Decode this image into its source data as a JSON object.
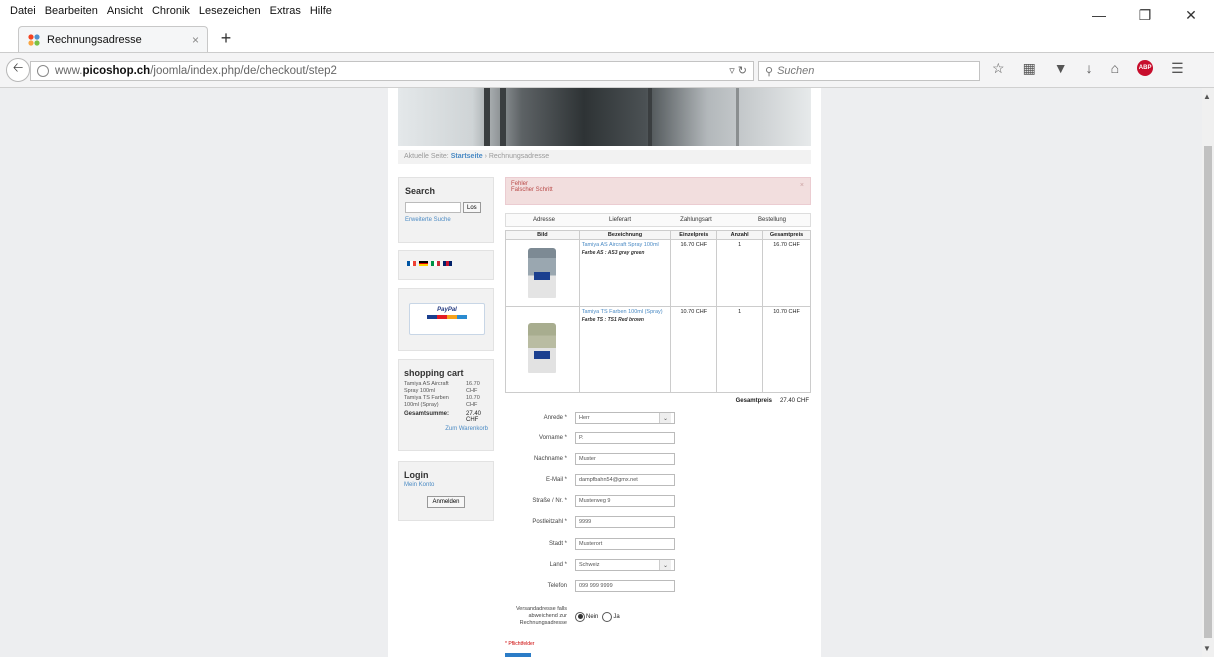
{
  "menu": [
    "Datei",
    "Bearbeiten",
    "Ansicht",
    "Chronik",
    "Lesezeichen",
    "Extras",
    "Hilfe"
  ],
  "tab": {
    "title": "Rechnungsadresse",
    "close": "×",
    "new": "+"
  },
  "url": {
    "prefix": "www.",
    "domain": "picoshop.ch",
    "path": "/joomla/index.php/de/checkout/step2"
  },
  "search_placeholder": "Suchen",
  "breadcrumb": {
    "label": "Aktuelle Seite:",
    "home": "Startseite",
    "sep": "›",
    "current": "Rechnungsadresse"
  },
  "sidebar": {
    "search": {
      "title": "Search",
      "button": "Los",
      "advanced": "Erweiterte Suche"
    },
    "cart": {
      "title": "shopping cart",
      "items": [
        {
          "name": "Tamiya AS Aircraft Spray 100ml",
          "price": "16.70 CHF"
        },
        {
          "name": "Tamiya TS Farben 100ml (Spray)",
          "price": "10.70 CHF"
        }
      ],
      "total_label": "Gesamtsumme:",
      "total": "27.40 CHF",
      "link": "Zum Warenkorb"
    },
    "login": {
      "title": "Login",
      "account": "Mein Konto",
      "button": "Anmelden"
    }
  },
  "alert": {
    "title": "Fehler",
    "message": "Falscher Schritt",
    "close": "×"
  },
  "steps": [
    "Adresse",
    "Lieferart",
    "Zahlungsart",
    "Bestellung"
  ],
  "table": {
    "headers": [
      "Bild",
      "Bezeichnung",
      "Einzelpreis",
      "Anzahl",
      "Gesamtpreis"
    ],
    "rows": [
      {
        "name": "Tamiya AS Aircraft Spray 100ml",
        "desc": "Farbe AS : AS3 gray green",
        "unit": "16.70 CHF",
        "qty": "1",
        "total": "16.70 CHF"
      },
      {
        "name": "Tamiya TS Farben 100ml (Spray)",
        "desc": "Farbe TS : TS1 Red brown",
        "unit": "10.70 CHF",
        "qty": "1",
        "total": "10.70 CHF"
      }
    ],
    "grand_label": "Gesamtpreis",
    "grand_total": "27.40 CHF"
  },
  "form": {
    "anrede": {
      "label": "Anrede *",
      "value": "Herr"
    },
    "vorname": {
      "label": "Vorname *",
      "value": "P."
    },
    "nachname": {
      "label": "Nachname *",
      "value": "Muster"
    },
    "email": {
      "label": "E-Mail *",
      "value": "dampfbahn54@gmx.net"
    },
    "strasse": {
      "label": "Straße / Nr. *",
      "value": "Musterweg 9"
    },
    "plz": {
      "label": "Postleitzahl *",
      "value": "9999"
    },
    "stadt": {
      "label": "Stadt *",
      "value": "Musterort"
    },
    "land": {
      "label": "Land *",
      "value": "Schweiz"
    },
    "telefon": {
      "label": "Telefon",
      "value": "099 999 9999"
    },
    "shipping": {
      "label": "Versandadresse falls abweichend zur Rechnungsadresse",
      "no": "Nein",
      "yes": "Ja"
    },
    "required_note": "* Pflichtfelder"
  }
}
